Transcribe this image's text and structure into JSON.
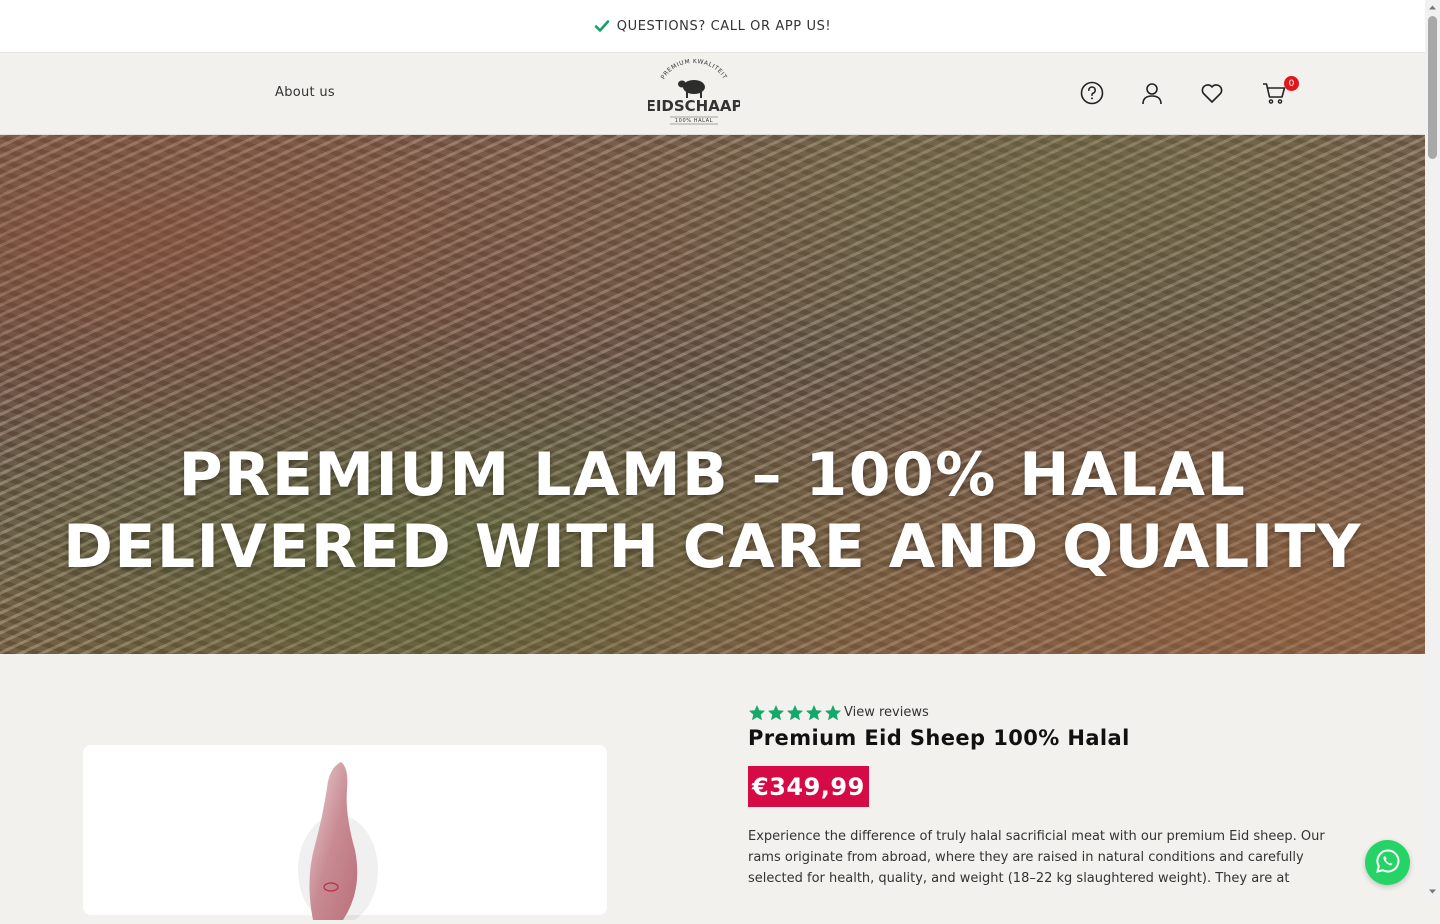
{
  "announcement": {
    "text": "QUESTIONS? CALL OR APP US!",
    "icon": "check-icon",
    "icon_color": "#16a06a"
  },
  "header": {
    "nav_about": "About us",
    "logo": {
      "arc_text": "PREMIUM KWALITEIT",
      "brand": "EIDSCHAAP",
      "sub": "100% HALAL"
    },
    "icons": [
      "help-icon",
      "account-icon",
      "wishlist-icon",
      "cart-icon"
    ],
    "cart_count": "0"
  },
  "hero": {
    "line1": "PREMIUM LAMB – 100% HALAL",
    "line2": "DELIVERED WITH CARE AND QUALITY"
  },
  "product": {
    "rating": 5,
    "rating_color": "#14a86b",
    "view_reviews": "View reviews",
    "title": "Premium Eid Sheep 100% Halal",
    "price": "€349,99",
    "price_bg": "#d60a45",
    "description": "Experience the difference of truly halal sacrificial meat with our premium Eid sheep. Our rams originate from abroad, where they are raised in natural conditions and carefully selected for health, quality, and weight (18–22 kg slaughtered weight). They are at"
  },
  "colors": {
    "page_bg": "#f2f1ed",
    "badge": "#e0161a",
    "whatsapp": "#25d366"
  }
}
